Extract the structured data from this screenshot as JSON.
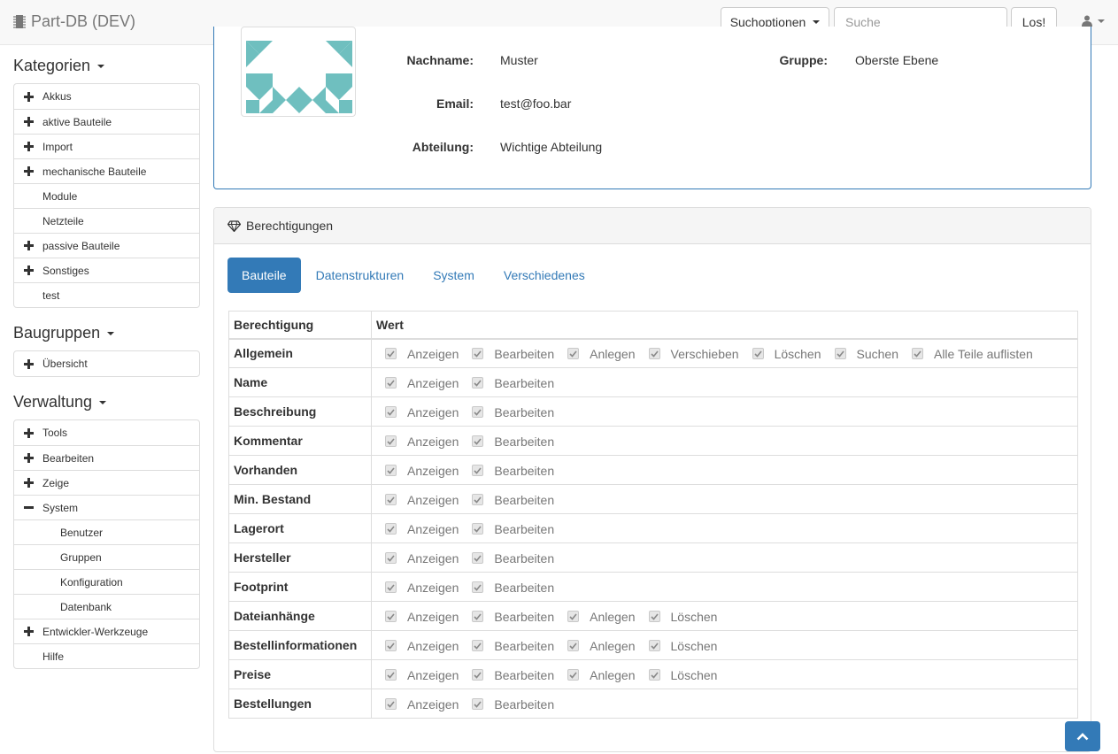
{
  "app": {
    "brand": "Part-DB (DEV)",
    "search_options_label": "Suchoptionen",
    "search_placeholder": "Suche",
    "go_label": "Los!"
  },
  "sidebar": {
    "categories_title": "Kategorien",
    "categories": [
      {
        "label": "Akkus",
        "expandable": true
      },
      {
        "label": "aktive Bauteile",
        "expandable": true
      },
      {
        "label": "Import",
        "expandable": true
      },
      {
        "label": "mechanische Bauteile",
        "expandable": true
      },
      {
        "label": "Module",
        "expandable": false
      },
      {
        "label": "Netzteile",
        "expandable": false
      },
      {
        "label": "passive Bauteile",
        "expandable": true
      },
      {
        "label": "Sonstiges",
        "expandable": true
      },
      {
        "label": "test",
        "expandable": false
      }
    ],
    "assemblies_title": "Baugruppen",
    "assemblies": [
      {
        "label": "Übersicht",
        "expandable": true
      }
    ],
    "admin_title": "Verwaltung",
    "admin": [
      {
        "label": "Tools",
        "state": "plus"
      },
      {
        "label": "Bearbeiten",
        "state": "plus"
      },
      {
        "label": "Zeige",
        "state": "plus"
      },
      {
        "label": "System",
        "state": "minus"
      },
      {
        "label": "Benutzer",
        "state": "child"
      },
      {
        "label": "Gruppen",
        "state": "child"
      },
      {
        "label": "Konfiguration",
        "state": "child"
      },
      {
        "label": "Datenbank",
        "state": "child"
      },
      {
        "label": "Entwickler-Werkzeuge",
        "state": "plus"
      },
      {
        "label": "Hilfe",
        "state": "none"
      }
    ]
  },
  "user": {
    "lastname_label": "Nachname:",
    "lastname": "Muster",
    "email_label": "Email:",
    "email": "test@foo.bar",
    "department_label": "Abteilung:",
    "department": "Wichtige Abteilung",
    "group_label": "Gruppe:",
    "group": "Oberste Ebene"
  },
  "permissions": {
    "title": "Berechtigungen",
    "tabs": [
      {
        "label": "Bauteile",
        "active": true
      },
      {
        "label": "Datenstrukturen",
        "active": false
      },
      {
        "label": "System",
        "active": false
      },
      {
        "label": "Verschiedenes",
        "active": false
      }
    ],
    "col_permission": "Berechtigung",
    "col_value": "Wert",
    "rows": [
      {
        "name": "Allgemein",
        "values": [
          "Anzeigen",
          "Bearbeiten",
          "Anlegen",
          "Verschieben",
          "Löschen",
          "Suchen",
          "Alle Teile auflisten"
        ]
      },
      {
        "name": "Name",
        "values": [
          "Anzeigen",
          "Bearbeiten"
        ]
      },
      {
        "name": "Beschreibung",
        "values": [
          "Anzeigen",
          "Bearbeiten"
        ]
      },
      {
        "name": "Kommentar",
        "values": [
          "Anzeigen",
          "Bearbeiten"
        ]
      },
      {
        "name": "Vorhanden",
        "values": [
          "Anzeigen",
          "Bearbeiten"
        ]
      },
      {
        "name": "Min. Bestand",
        "values": [
          "Anzeigen",
          "Bearbeiten"
        ]
      },
      {
        "name": "Lagerort",
        "values": [
          "Anzeigen",
          "Bearbeiten"
        ]
      },
      {
        "name": "Hersteller",
        "values": [
          "Anzeigen",
          "Bearbeiten"
        ]
      },
      {
        "name": "Footprint",
        "values": [
          "Anzeigen",
          "Bearbeiten"
        ]
      },
      {
        "name": "Dateianhänge",
        "values": [
          "Anzeigen",
          "Bearbeiten",
          "Anlegen",
          "Löschen"
        ]
      },
      {
        "name": "Bestellinformationen",
        "values": [
          "Anzeigen",
          "Bearbeiten",
          "Anlegen",
          "Löschen"
        ]
      },
      {
        "name": "Preise",
        "values": [
          "Anzeigen",
          "Bearbeiten",
          "Anlegen",
          "Löschen"
        ]
      },
      {
        "name": "Bestellungen",
        "values": [
          "Anzeigen",
          "Bearbeiten"
        ]
      }
    ]
  },
  "colors": {
    "primary": "#337ab7",
    "avatar": "#6fbfbf"
  }
}
